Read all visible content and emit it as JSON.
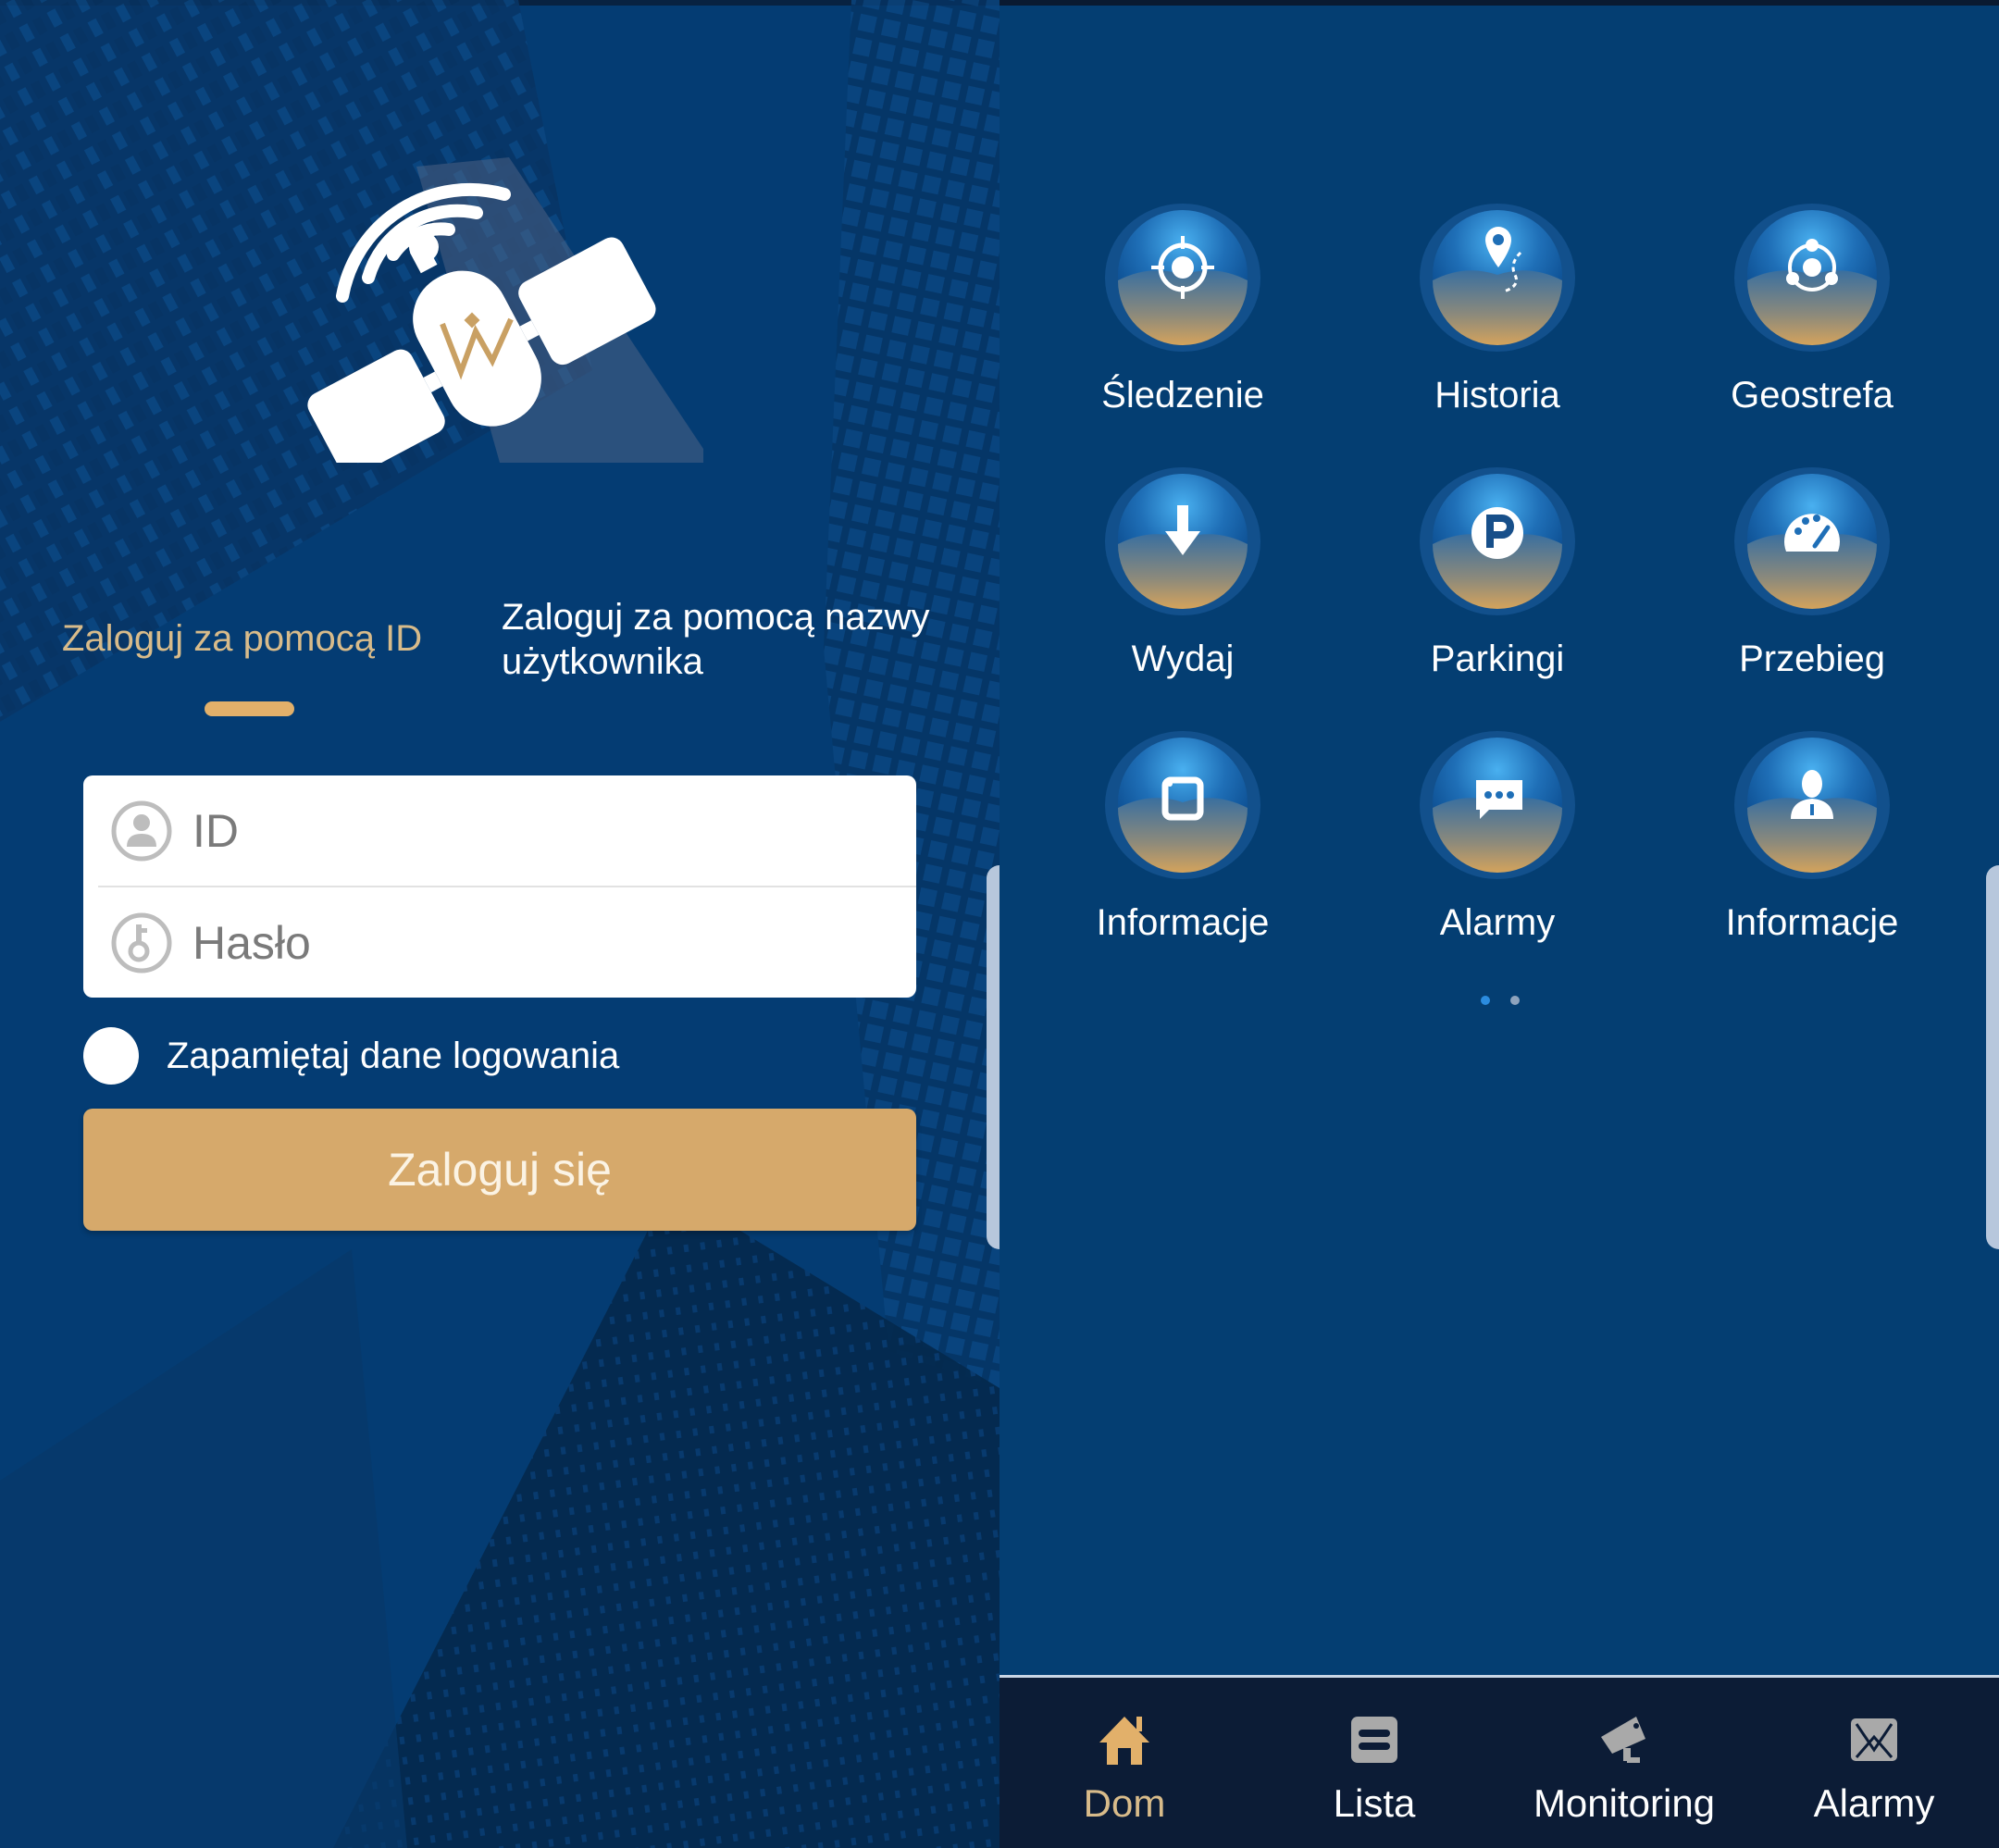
{
  "login_screen": {
    "tabs": [
      {
        "label": "Zaloguj za pomocą ID",
        "active": true
      },
      {
        "label": "Zaloguj za pomocą nazwy użytkownika",
        "active": false
      }
    ],
    "id_field": {
      "placeholder": "ID",
      "value": "",
      "icon": "user-icon"
    },
    "password_field": {
      "placeholder": "Hasło",
      "value": "",
      "icon": "key-icon"
    },
    "remember_me": {
      "label": "Zapamiętaj dane logowania",
      "checked": false
    },
    "login_button": "Zaloguj się",
    "colors": {
      "accent": "#d6a96b",
      "background": "#053d73",
      "active_tab": "#d8bb8a"
    }
  },
  "home_screen": {
    "grid": [
      {
        "label": "Śledzenie",
        "icon": "crosshair-icon"
      },
      {
        "label": "Historia",
        "icon": "route-pin-icon"
      },
      {
        "label": "Geostrefa",
        "icon": "geofence-icon"
      },
      {
        "label": "Wydaj",
        "icon": "arrow-down-icon"
      },
      {
        "label": "Parkingi",
        "icon": "parking-icon"
      },
      {
        "label": "Przebieg",
        "icon": "speedometer-icon"
      },
      {
        "label": "Informacje",
        "icon": "window-icon"
      },
      {
        "label": "Alarmy",
        "icon": "chat-bubble-icon"
      },
      {
        "label": "Informacje",
        "icon": "person-icon"
      }
    ],
    "page_indicator": {
      "current": 1,
      "total": 2
    },
    "bottom_nav": [
      {
        "label": "Dom",
        "icon": "home-icon",
        "active": true
      },
      {
        "label": "Lista",
        "icon": "list-icon",
        "active": false
      },
      {
        "label": "Monitoring",
        "icon": "cctv-camera-icon",
        "active": false
      },
      {
        "label": "Alarmy",
        "icon": "envelope-icon",
        "active": false
      }
    ],
    "colors": {
      "background": "#043e72",
      "nav_background": "#0c1c36",
      "active_nav": "#d8bb8a"
    }
  }
}
